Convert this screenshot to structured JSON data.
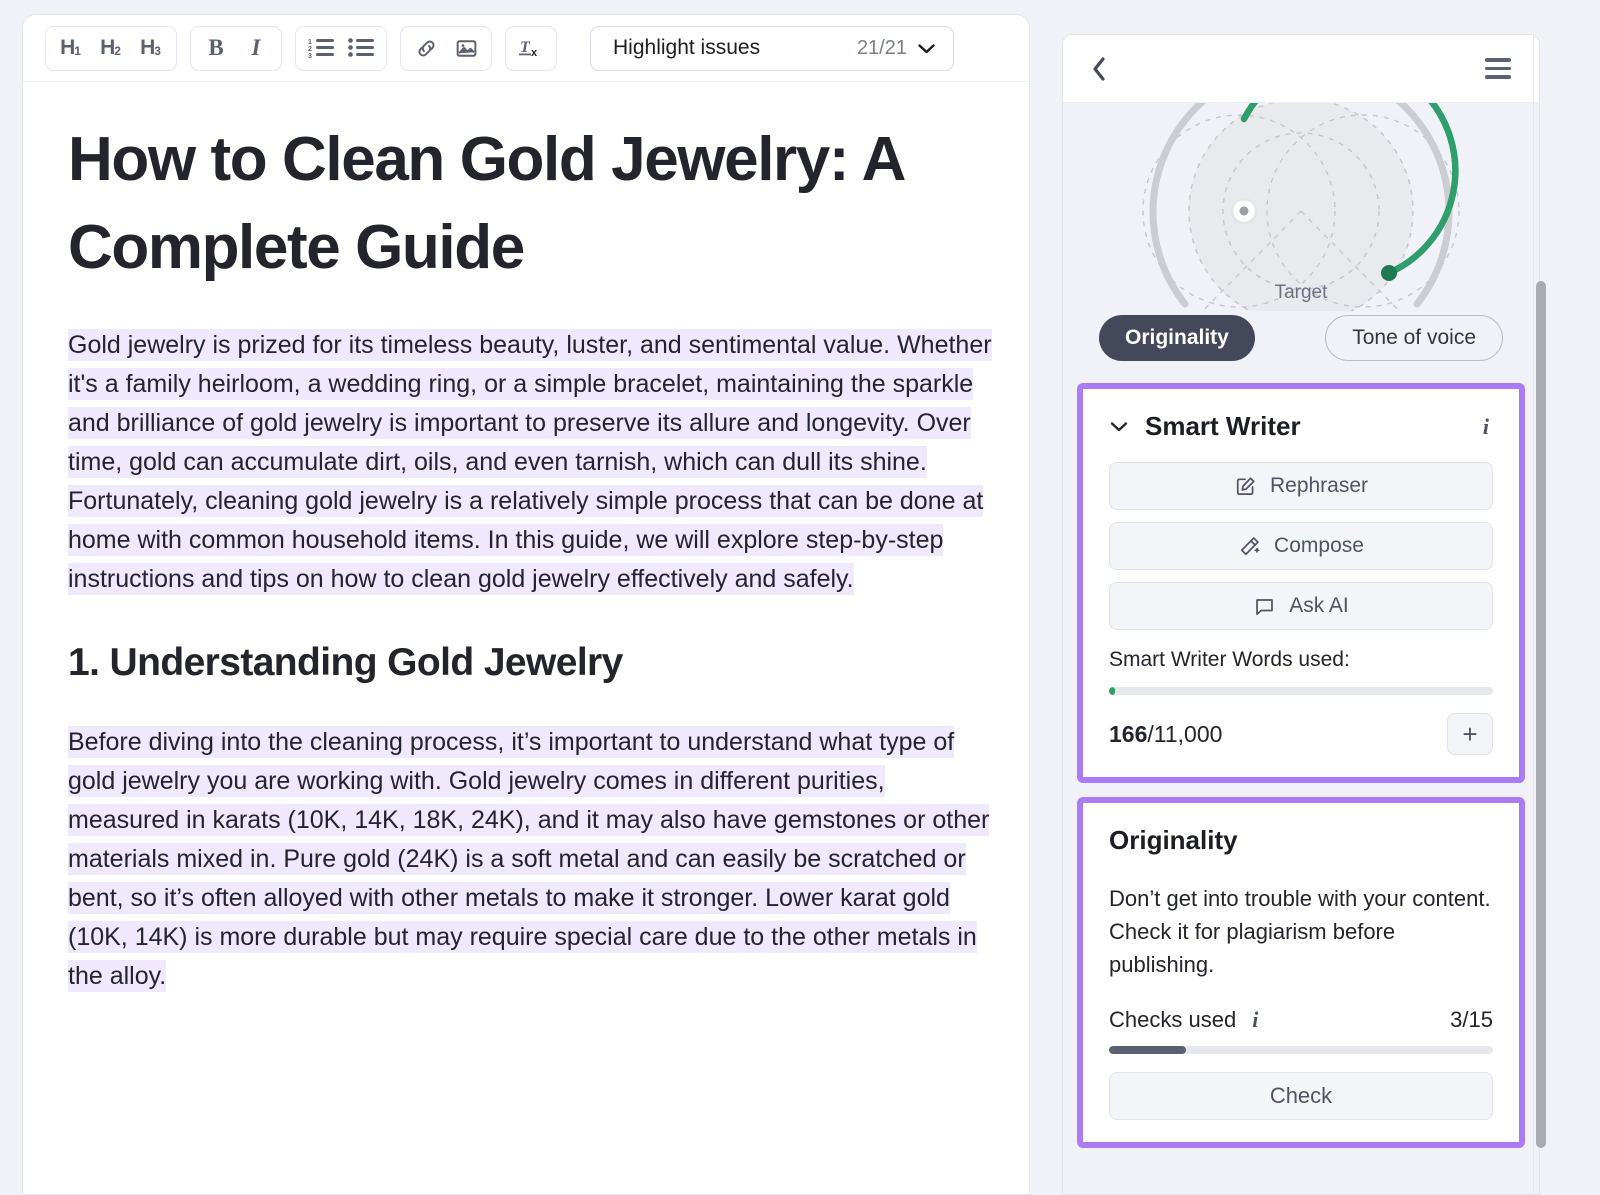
{
  "editor": {
    "toolbar": {
      "heading_buttons": [
        {
          "label": "H",
          "sub": "1",
          "name": "heading-1-button"
        },
        {
          "label": "H",
          "sub": "2",
          "name": "heading-2-button"
        },
        {
          "label": "H",
          "sub": "3",
          "name": "heading-3-button"
        }
      ],
      "bold_label": "B",
      "italic_label": "I",
      "ordered_list_icon": "ordered-list-icon",
      "bullet_list_icon": "bullet-list-icon",
      "link_icon": "link-icon",
      "image_icon": "image-icon",
      "clear_format_icon": "clear-formatting-icon",
      "highlight_select": {
        "label": "Highlight issues",
        "count": "21/21",
        "chevron_icon": "chevron-down-icon"
      }
    },
    "document": {
      "title": "How to Clean Gold Jewelry: A Complete Guide",
      "paragraph_1": "Gold jewelry is prized for its timeless beauty, luster, and sentimental value. Whether it's a family heirloom, a wedding ring, or a simple bracelet, maintaining the sparkle and brilliance of gold jewelry is important to preserve its allure and longevity. Over time, gold can accumulate dirt, oils, and even tarnish, which can dull its shine. Fortunately, cleaning gold jewelry is a relatively simple process that can be done at home with common household items. In this guide, we will explore step-by-step instructions and tips on how to clean gold jewelry effectively and safely.",
      "heading_1": "1. Understanding Gold Jewelry",
      "paragraph_2": "Before diving into the cleaning process, it’s important to understand what type of gold jewelry you are working with. Gold jewelry comes in different purities, measured in karats (10K, 14K, 18K, 24K), and it may also have gemstones or other materials mixed in. Pure gold (24K) is a soft metal and can easily be scratched or bent, so it’s often alloyed with other metals to make it stronger. Lower karat gold (10K, 14K) is more durable but may require special care due to the other metals in the alloy."
    }
  },
  "sidebar": {
    "header": {
      "back_icon": "chevron-left-icon",
      "menu_icon": "hamburger-menu-icon"
    },
    "gauge": {
      "target_label": "Target",
      "arc_color": "#2e9e6b",
      "track_color": "#cbcdd2"
    },
    "pills": [
      {
        "label": "Originality",
        "state": "active"
      },
      {
        "label": "Tone of voice",
        "state": "inactive"
      }
    ],
    "smart_writer": {
      "title": "Smart Writer",
      "collapse_icon": "chevron-down-icon",
      "info_icon": "info-icon",
      "actions": [
        {
          "label": "Rephraser",
          "icon": "pencil-square-icon"
        },
        {
          "label": "Compose",
          "icon": "magic-wand-icon"
        },
        {
          "label": "Ask AI",
          "icon": "chat-bubble-icon"
        }
      ],
      "usage_label": "Smart Writer Words used:",
      "used": "166",
      "limit": "/11,000",
      "progress_percent": 1.5,
      "add_button_label": "+"
    },
    "originality": {
      "title": "Originality",
      "description": "Don’t get into trouble with your content. Check it for plagiarism before publishing.",
      "checks_label": "Checks used",
      "checks_info_icon": "info-icon",
      "checks_value": "3/15",
      "progress_percent": 20,
      "check_button_label": "Check"
    }
  },
  "colors": {
    "accent_purple": "#ab7bf5",
    "highlight_bg": "#f0e8fc",
    "green": "#2e9e6b",
    "dark": "#44485a"
  }
}
